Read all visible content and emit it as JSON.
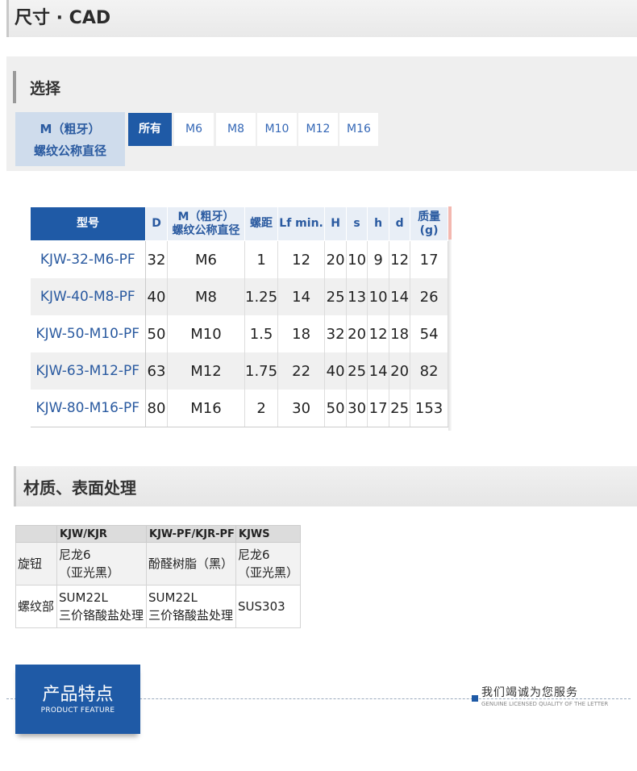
{
  "header": {
    "title": "尺寸 · CAD"
  },
  "selection": {
    "title": "选择",
    "param_label_line1": "M（粗牙）",
    "param_label_line2": "螺纹公称直径",
    "options": [
      "所有",
      "M6",
      "M8",
      "M10",
      "M12",
      "M16"
    ],
    "selected": "所有"
  },
  "spec_table": {
    "headers": {
      "model": "型号",
      "d_upper": "D",
      "m_line1": "M（粗牙）",
      "m_line2": "螺纹公称直径",
      "pitch": "螺距",
      "lf": "Lf min.",
      "h_upper": "H",
      "s": "s",
      "h_lower": "h",
      "d_lower": "d",
      "mass_line1": "质量",
      "mass_line2": "(g)"
    },
    "rows": [
      [
        "KJW-32-M6-PF",
        "32",
        "M6",
        "1",
        "12",
        "20",
        "10",
        "9",
        "12",
        "17"
      ],
      [
        "KJW-40-M8-PF",
        "40",
        "M8",
        "1.25",
        "14",
        "25",
        "13",
        "10",
        "14",
        "26"
      ],
      [
        "KJW-50-M10-PF",
        "50",
        "M10",
        "1.5",
        "18",
        "32",
        "20",
        "12",
        "18",
        "54"
      ],
      [
        "KJW-63-M12-PF",
        "63",
        "M12",
        "1.75",
        "22",
        "40",
        "25",
        "14",
        "20",
        "82"
      ],
      [
        "KJW-80-M16-PF",
        "80",
        "M16",
        "2",
        "30",
        "50",
        "30",
        "17",
        "25",
        "153"
      ]
    ]
  },
  "material": {
    "title": "材质、表面处理",
    "headers": [
      "",
      "KJW/KJR",
      "KJW-PF/KJR-PF",
      "KJWS"
    ],
    "rows": [
      {
        "label": "旋钮",
        "c1a": "尼龙6",
        "c1b": "（亚光黑）",
        "c2a": "酚醛树脂（黑）",
        "c3a": "尼龙6",
        "c3b": "（亚光黑）"
      },
      {
        "label": "螺纹部",
        "c1a": "SUM22L",
        "c1b": "三价铬酸盐处理",
        "c2a": "SUM22L",
        "c2b": "三价铬酸盐处理",
        "c3a": "SUS303"
      }
    ]
  },
  "feature": {
    "title": "产品特点",
    "subtitle": "PRODUCT FEATURE",
    "service": "我们竭诚为您服务",
    "service_sub": "GENUINE LICENSED QUALITY OF THE LETTER"
  },
  "colors": {
    "accent": "#1f5aa6",
    "label_blue": "#2a5aa0",
    "header_bg": "#e8eef6"
  }
}
